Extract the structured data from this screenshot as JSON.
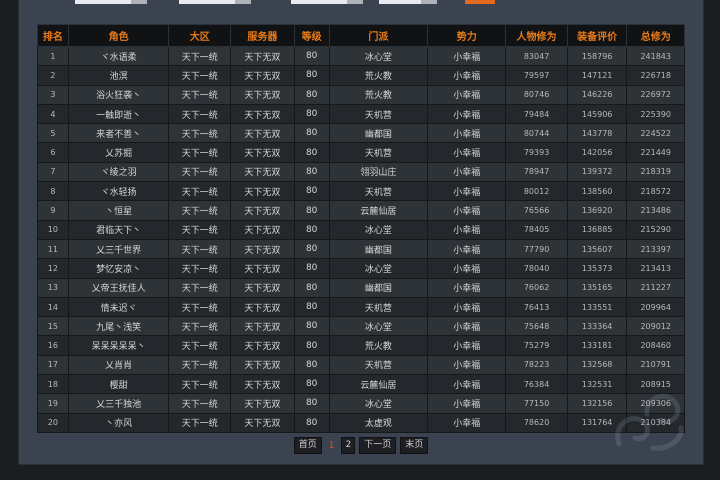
{
  "headers": [
    "排名",
    "角色",
    "大区",
    "服务器",
    "等级",
    "门派",
    "势力",
    "人物修为",
    "装备评价",
    "总修为"
  ],
  "rows": [
    [
      "1",
      "ヾ水语柔",
      "天下一统",
      "天下无双",
      "80",
      "冰心堂",
      "小幸福",
      "83047",
      "158796",
      "241843"
    ],
    [
      "2",
      "池溟",
      "天下一统",
      "天下无双",
      "80",
      "荒火教",
      "小幸福",
      "79597",
      "147121",
      "226718"
    ],
    [
      "3",
      "浴火狂袭丶",
      "天下一统",
      "天下无双",
      "80",
      "荒火教",
      "小幸福",
      "80746",
      "146226",
      "226972"
    ],
    [
      "4",
      "一触即逝丶",
      "天下一统",
      "天下无双",
      "80",
      "天机营",
      "小幸福",
      "79484",
      "145906",
      "225390"
    ],
    [
      "5",
      "来者不善丶",
      "天下一统",
      "天下无双",
      "80",
      "幽都国",
      "小幸福",
      "80744",
      "143778",
      "224522"
    ],
    [
      "6",
      "乂苏掘",
      "天下一统",
      "天下无双",
      "80",
      "天机营",
      "小幸福",
      "79393",
      "142056",
      "221449"
    ],
    [
      "7",
      "ヾ绫之羽",
      "天下一统",
      "天下无双",
      "80",
      "翎羽山庄",
      "小幸福",
      "78947",
      "139372",
      "218319"
    ],
    [
      "8",
      "ヾ水轻扬",
      "天下一统",
      "天下无双",
      "80",
      "天机营",
      "小幸福",
      "80012",
      "138560",
      "218572"
    ],
    [
      "9",
      "丶恒星",
      "天下一统",
      "天下无双",
      "80",
      "云麓仙居",
      "小幸福",
      "76566",
      "136920",
      "213486"
    ],
    [
      "10",
      "君临天下丶",
      "天下一统",
      "天下无双",
      "80",
      "冰心堂",
      "小幸福",
      "78405",
      "136885",
      "215290"
    ],
    [
      "11",
      "乂三千世界",
      "天下一统",
      "天下无双",
      "80",
      "幽都国",
      "小幸福",
      "77790",
      "135607",
      "213397"
    ],
    [
      "12",
      "梦忆安凉丶",
      "天下一统",
      "天下无双",
      "80",
      "冰心堂",
      "小幸福",
      "78040",
      "135373",
      "213413"
    ],
    [
      "13",
      "乂帝王抚佳人",
      "天下一统",
      "天下无双",
      "80",
      "幽都国",
      "小幸福",
      "76062",
      "135165",
      "211227"
    ],
    [
      "14",
      "情未迟ヾ",
      "天下一统",
      "天下无双",
      "80",
      "天机营",
      "小幸福",
      "76413",
      "133551",
      "209964"
    ],
    [
      "15",
      "九尾丶浅笑",
      "天下一统",
      "天下无双",
      "80",
      "冰心堂",
      "小幸福",
      "75648",
      "133364",
      "209012"
    ],
    [
      "16",
      "呆呆呆呆呆丶",
      "天下一统",
      "天下无双",
      "80",
      "荒火教",
      "小幸福",
      "75279",
      "133181",
      "208460"
    ],
    [
      "17",
      "乂肖肖",
      "天下一统",
      "天下无双",
      "80",
      "天机营",
      "小幸福",
      "78223",
      "132568",
      "210791"
    ],
    [
      "18",
      "樱甜",
      "天下一统",
      "天下无双",
      "80",
      "云麓仙居",
      "小幸福",
      "76384",
      "132531",
      "208915"
    ],
    [
      "19",
      "乂三千独池",
      "天下一统",
      "天下无双",
      "80",
      "冰心堂",
      "小幸福",
      "77150",
      "132156",
      "209306"
    ],
    [
      "20",
      "丶亦风",
      "天下一统",
      "天下无双",
      "80",
      "太虚观",
      "小幸福",
      "78620",
      "131764",
      "210384"
    ]
  ],
  "pager": {
    "first": "首页",
    "current": "1",
    "page2": "2",
    "next": "下一页",
    "last": "末页"
  },
  "colors": {
    "header_text": "#e67b1c",
    "current_page": "#e04b1e",
    "search_button": "#e2691e"
  },
  "icons": {
    "watermark": "swirl-cloud-watermark-icon"
  }
}
